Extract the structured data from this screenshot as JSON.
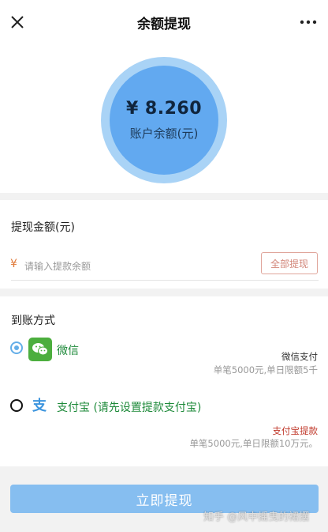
{
  "header": {
    "title": "余额提现",
    "close_icon": "close-icon",
    "more_icon": "more-icon"
  },
  "balance": {
    "amount": "¥ 8.260",
    "label": "账户余额(元)"
  },
  "withdraw": {
    "section_title": "提现金额(元)",
    "currency_symbol": "¥",
    "placeholder": "请输入提款余额",
    "value": "",
    "all_button": "全部提现"
  },
  "methods": {
    "section_title": "到账方式",
    "items": [
      {
        "name": "微信",
        "icon": "wechat-icon",
        "selected": true,
        "note_title": "微信支付",
        "note_detail": "单笔5000元,单日限额5千"
      },
      {
        "name": "支付宝 (请先设置提款支付宝)",
        "icon": "alipay-icon",
        "selected": false,
        "note_title": "支付宝提款",
        "note_detail": "单笔5000元,单日限额10万元。"
      }
    ]
  },
  "footer": {
    "submit_label": "立即提现",
    "watermark": "知乎 @风中摇曳的裙摆"
  },
  "colors": {
    "accent": "#62a9f0",
    "button": "#86bef0",
    "wechat_green": "#4cae3e",
    "alipay_blue": "#3d95de",
    "warning_red": "#c0392b"
  }
}
